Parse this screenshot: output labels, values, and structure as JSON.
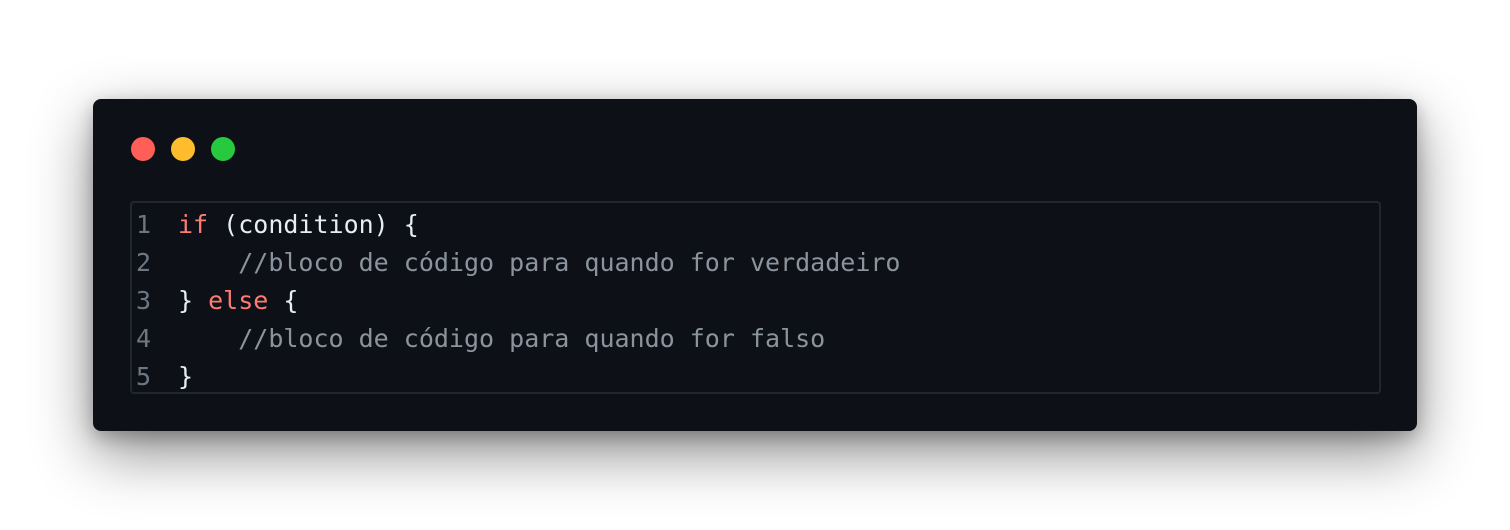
{
  "window": {
    "controls": {
      "close_color": "#ff5f56",
      "minimize_color": "#ffbd2e",
      "maximize_color": "#27c93f"
    }
  },
  "code": {
    "lines": [
      {
        "number": "1",
        "indent": "",
        "keyword": "if",
        "text": " (condition) {",
        "comment": ""
      },
      {
        "number": "2",
        "indent": "    ",
        "keyword": "",
        "text": "",
        "comment": "//bloco de código para quando for verdadeiro"
      },
      {
        "number": "3",
        "indent": "",
        "keyword": "else",
        "text_before": "} ",
        "text": " {",
        "comment": ""
      },
      {
        "number": "4",
        "indent": "    ",
        "keyword": "",
        "text": "",
        "comment": "//bloco de código para quando for falso"
      },
      {
        "number": "5",
        "indent": "",
        "keyword": "",
        "text": "}",
        "comment": ""
      }
    ]
  }
}
